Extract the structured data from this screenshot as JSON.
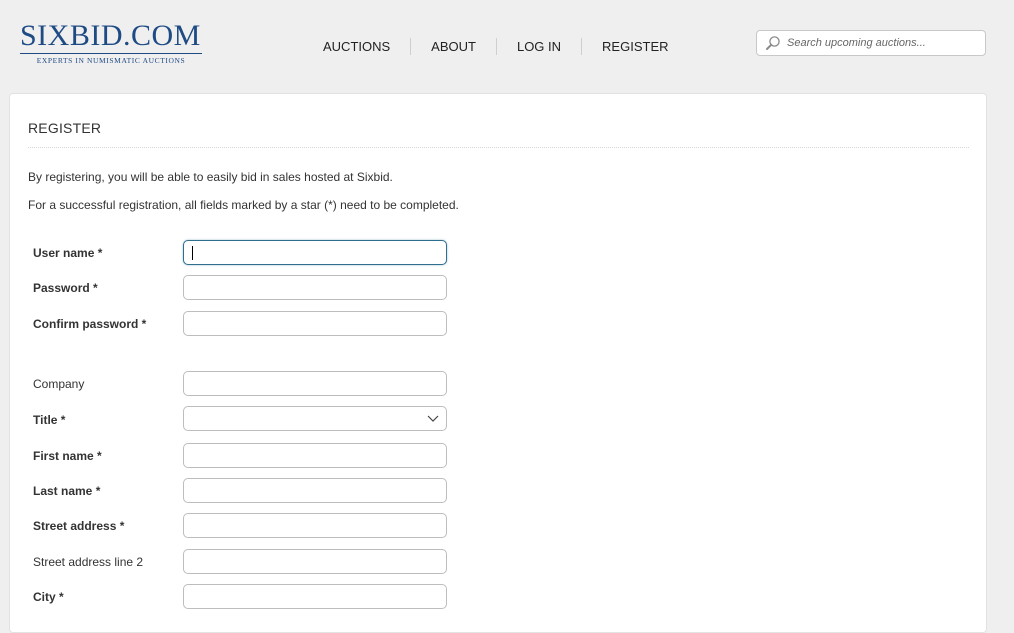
{
  "header": {
    "logo": {
      "main": "SIXBID.COM",
      "tagline": "Experts in numismatic auctions"
    },
    "nav": [
      {
        "label": "AUCTIONS"
      },
      {
        "label": "ABOUT"
      },
      {
        "label": "LOG IN"
      },
      {
        "label": "REGISTER"
      }
    ],
    "search": {
      "placeholder": "Search upcoming auctions...",
      "icon": "magnifier-icon"
    }
  },
  "page": {
    "title": "REGISTER",
    "intro": [
      "By registering, you will be able to easily bid in sales hosted at Sixbid.",
      "For a successful registration, all fields marked by a star (*) need to be completed."
    ]
  },
  "form": {
    "fields": [
      {
        "label": "User name *",
        "value": "",
        "required": true,
        "type": "text",
        "focused": true
      },
      {
        "label": "Password *",
        "value": "",
        "required": true,
        "type": "password"
      },
      {
        "label": "Confirm password *",
        "value": "",
        "required": true,
        "type": "password"
      },
      {
        "label": "Company",
        "value": "",
        "required": false,
        "type": "text"
      },
      {
        "label": "Title *",
        "value": "",
        "required": true,
        "type": "select"
      },
      {
        "label": "First name *",
        "value": "",
        "required": true,
        "type": "text"
      },
      {
        "label": "Last name *",
        "value": "",
        "required": true,
        "type": "text"
      },
      {
        "label": "Street address *",
        "value": "",
        "required": true,
        "type": "text"
      },
      {
        "label": "Street address line 2",
        "value": "",
        "required": false,
        "type": "text"
      },
      {
        "label": "City *",
        "value": "",
        "required": true,
        "type": "text"
      }
    ]
  },
  "colors": {
    "brand": "#1f4b85",
    "focus_border": "#2e6e8e",
    "background": "#efefef"
  }
}
